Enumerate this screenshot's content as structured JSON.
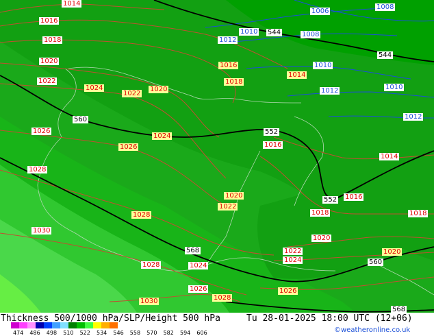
{
  "colors": {
    "c534": "#00a000",
    "c540": "#12a012",
    "c546": "#1aa91a",
    "c552": "#18b418",
    "c558": "#30c830",
    "c564": "#4ad84a",
    "c570": "#66ee44",
    "isobar": "#c05030",
    "blue_isobar": "#1a4fd8",
    "height": "#000000"
  },
  "isobar_labels": [
    {
      "text": "1014",
      "style": "red"
    },
    {
      "text": "1016",
      "style": "red"
    },
    {
      "text": "1018",
      "style": "red"
    },
    {
      "text": "1020",
      "style": "red"
    },
    {
      "text": "1022",
      "style": "red"
    },
    {
      "text": "1024",
      "style": "redy"
    },
    {
      "text": "1022",
      "style": "redy"
    },
    {
      "text": "1020",
      "style": "redy"
    },
    {
      "text": "1016",
      "style": "redy"
    },
    {
      "text": "1018",
      "style": "redy"
    },
    {
      "text": "1014",
      "style": "redy"
    },
    {
      "text": "1026",
      "style": "red"
    },
    {
      "text": "1024",
      "style": "redy"
    },
    {
      "text": "1026",
      "style": "redy"
    },
    {
      "text": "1016",
      "style": "red"
    },
    {
      "text": "1014",
      "style": "red"
    },
    {
      "text": "1028",
      "style": "red"
    },
    {
      "text": "1016",
      "style": "red"
    },
    {
      "text": "1018",
      "style": "red"
    },
    {
      "text": "1018",
      "style": "red"
    },
    {
      "text": "1020",
      "style": "redy"
    },
    {
      "text": "1022",
      "style": "redy"
    },
    {
      "text": "1028",
      "style": "redy"
    },
    {
      "text": "1020",
      "style": "red"
    },
    {
      "text": "1030",
      "style": "red"
    },
    {
      "text": "1022",
      "style": "red"
    },
    {
      "text": "1024",
      "style": "red"
    },
    {
      "text": "1020",
      "style": "redy"
    },
    {
      "text": "1028",
      "style": "red"
    },
    {
      "text": "1024",
      "style": "red"
    },
    {
      "text": "1026",
      "style": "red"
    },
    {
      "text": "1028",
      "style": "redy"
    },
    {
      "text": "1026",
      "style": "redy"
    },
    {
      "text": "1030",
      "style": "redy"
    },
    {
      "text": "1006",
      "style": "blue"
    },
    {
      "text": "1008",
      "style": "blue"
    },
    {
      "text": "1010",
      "style": "blue"
    },
    {
      "text": "1012",
      "style": "blue"
    },
    {
      "text": "1008",
      "style": "blue"
    },
    {
      "text": "1010",
      "style": "blue"
    },
    {
      "text": "1012",
      "style": "blue"
    },
    {
      "text": "1010",
      "style": "blue"
    },
    {
      "text": "1012",
      "style": "blue"
    }
  ],
  "height_labels": [
    "544",
    "544",
    "560",
    "552",
    "552",
    "568",
    "560",
    "568"
  ],
  "footer": {
    "left_title": "Thickness 500/1000 hPa/SLP/Height 500 hPa",
    "datetime": "Tu 28-01-2025 18:00 UTC (12+06)",
    "credit": "©weatheronline.co.uk"
  },
  "legend": {
    "ticks": [
      "474",
      "486",
      "498",
      "510",
      "522",
      "534",
      "546",
      "558",
      "570",
      "582",
      "594",
      "606"
    ],
    "swatches": [
      "#d000d0",
      "#ff40ff",
      "#ff90ff",
      "#0000b0",
      "#0040ff",
      "#40a0ff",
      "#80e0ff",
      "#008000",
      "#00c000",
      "#40ff40",
      "#ffff00",
      "#ffb000",
      "#ff7000"
    ]
  }
}
